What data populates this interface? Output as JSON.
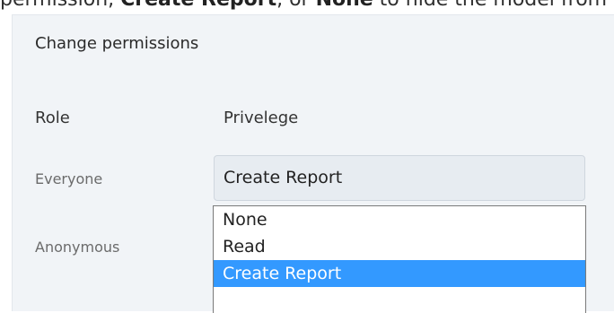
{
  "intro": {
    "prefix": "permission, ",
    "bold1": "Create Report",
    "mid": ", or ",
    "bold2": "None",
    "suffix": " to hide the model from"
  },
  "dialog": {
    "title": "Change permissions",
    "headers": {
      "role": "Role",
      "privilege": "Privelege"
    },
    "rows": [
      {
        "role": "Everyone",
        "privilege": "Create Report"
      },
      {
        "role": "Anonymous",
        "privilege": ""
      }
    ],
    "dropdown": {
      "options": [
        "None",
        "Read",
        "Create Report"
      ],
      "selected": "Create Report"
    }
  },
  "colors": {
    "panel_bg": "#f1f4f7",
    "select_bg": "#e7ecf1",
    "highlight": "#3399ff"
  }
}
